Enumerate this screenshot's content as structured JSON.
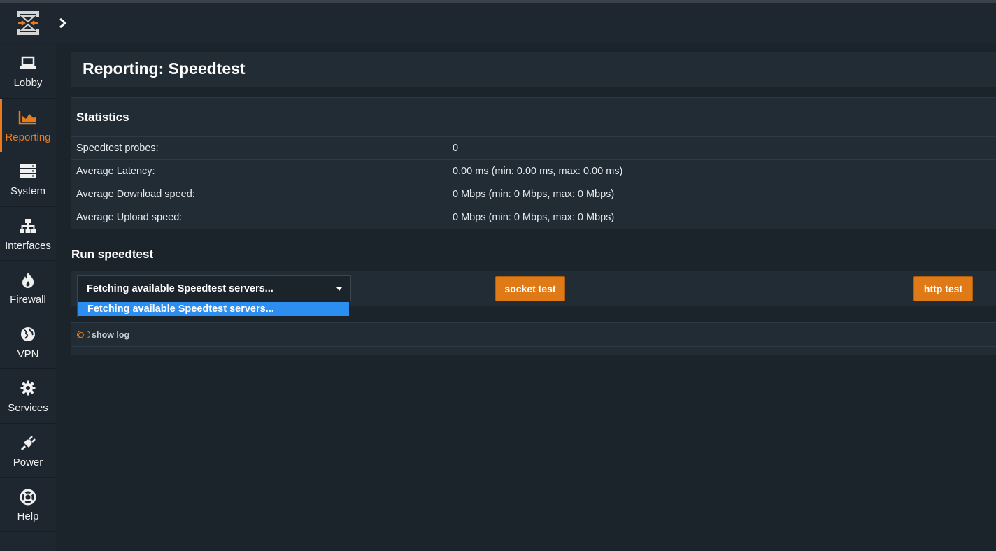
{
  "header": {
    "title": "Reporting: Speedtest"
  },
  "sidebar": {
    "items": [
      {
        "label": "Lobby",
        "icon": "laptop-icon",
        "active": false
      },
      {
        "label": "Reporting",
        "icon": "area-chart-icon",
        "active": true
      },
      {
        "label": "System",
        "icon": "server-icon",
        "active": false
      },
      {
        "label": "Interfaces",
        "icon": "sitemap-icon",
        "active": false
      },
      {
        "label": "Firewall",
        "icon": "fire-icon",
        "active": false
      },
      {
        "label": "VPN",
        "icon": "globe-icon",
        "active": false
      },
      {
        "label": "Services",
        "icon": "gear-icon",
        "active": false
      },
      {
        "label": "Power",
        "icon": "plug-icon",
        "active": false
      },
      {
        "label": "Help",
        "icon": "life-ring-icon",
        "active": false
      }
    ]
  },
  "statistics": {
    "title": "Statistics",
    "rows": [
      {
        "label": "Speedtest probes:",
        "value": "0"
      },
      {
        "label": "Average Latency:",
        "value": "0.00 ms (min: 0.00 ms, max: 0.00 ms)"
      },
      {
        "label": "Average Download speed:",
        "value": "0 Mbps (min: 0 Mbps, max: 0 Mbps)"
      },
      {
        "label": "Average Upload speed:",
        "value": "0 Mbps (min: 0 Mbps, max: 0 Mbps)"
      }
    ]
  },
  "run": {
    "title": "Run speedtest",
    "server_select": {
      "selected": "Fetching available Speedtest servers...",
      "options": [
        "Fetching available Speedtest servers..."
      ]
    },
    "socket_button": "socket test",
    "http_button": "http test"
  },
  "log": {
    "toggle_label": "show log"
  },
  "colors": {
    "accent": "#e07a17",
    "background": "#1b232b",
    "panel": "#222c35",
    "highlight": "#2c8ef1"
  }
}
